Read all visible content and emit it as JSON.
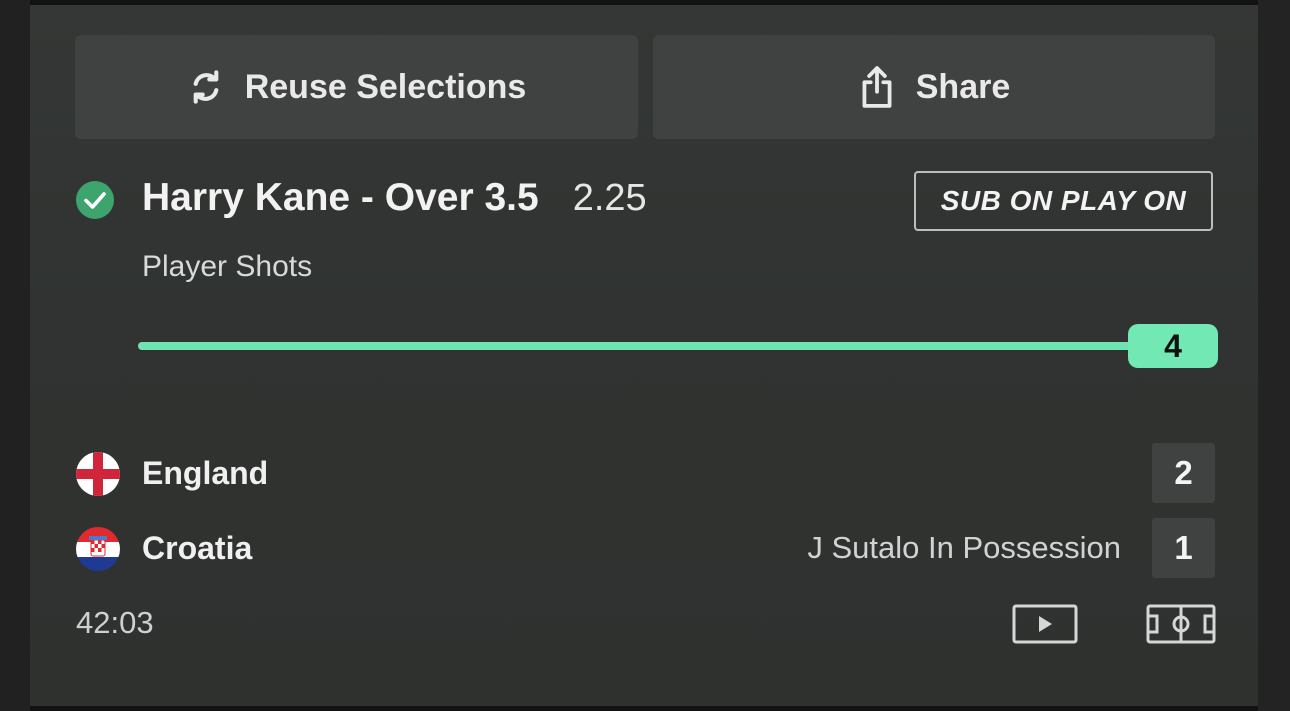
{
  "actions": {
    "reuse_label": "Reuse Selections",
    "share_label": "Share"
  },
  "selection": {
    "name": "Harry Kane - Over 3.5",
    "odds": "2.25",
    "badge": "SUB ON PLAY ON",
    "market": "Player Shots",
    "status": "won",
    "progress_value": "4",
    "progress_fraction": 1.0
  },
  "match": {
    "teams": [
      {
        "name": "England",
        "score": "2",
        "info": ""
      },
      {
        "name": "Croatia",
        "score": "1",
        "info": "J Sutalo In Possession"
      }
    ],
    "clock": "42:03"
  },
  "icons": {
    "reuse": "refresh-icon",
    "share": "share-icon",
    "status": "check-circle-icon",
    "video": "video-play-icon",
    "pitch": "pitch-icon"
  },
  "colors": {
    "accent": "#72e8b5",
    "check": "#3da46e",
    "button_bg": "#3f4240"
  }
}
